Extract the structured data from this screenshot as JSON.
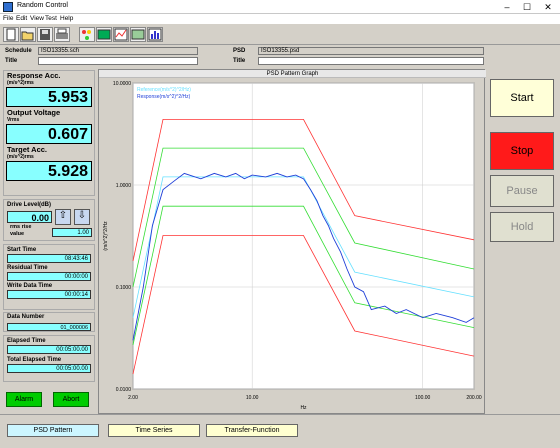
{
  "window": {
    "title": "Random Control",
    "min": "–",
    "max": "☐",
    "close": "✕"
  },
  "menu": [
    "File",
    "Edit",
    "View",
    "Test",
    "Help"
  ],
  "toolbar": {
    "icons": [
      "new-file-icon",
      "open-file-icon",
      "save-icon",
      "print-icon",
      "traffic-light-icon",
      "monitor-icon",
      "chart-icon",
      "display-icon",
      "bar-chart-icon"
    ]
  },
  "info": {
    "schedule_label": "Schedule",
    "schedule_value": "ISO13355.sch",
    "psd_label": "PSD",
    "psd_value": "ISO13355.psd",
    "title_label": "Title",
    "title_value": "",
    "title2_label": "Title",
    "title2_value": ""
  },
  "readouts": {
    "response": {
      "label": "Response Acc.",
      "unit": "(m/s^2)rms",
      "value": "5.953"
    },
    "output": {
      "label": "Output Voltage",
      "unit": "Vrms",
      "value": "0.607"
    },
    "target": {
      "label": "Target Acc.",
      "unit": "(m/s^2)rms",
      "value": "5.928"
    }
  },
  "drive": {
    "label": "Drive Level(dB)",
    "value": "0.00",
    "rise_label": "rms rise",
    "rise_label2": "value",
    "rise_value": "1.00"
  },
  "times": {
    "start": {
      "label": "Start Time",
      "value": "08:43:46"
    },
    "residual": {
      "label": "Residual Time",
      "value": "00:00:00"
    },
    "write": {
      "label": "Write Data Time",
      "value": "00:00:14"
    },
    "datanum": {
      "label": "Data Number",
      "value": "01_000006"
    },
    "elapsed": {
      "label": "Elapsed Time",
      "value": "00:05:00.00"
    },
    "total": {
      "label": "Total Elapsed Time",
      "value": "00:05:00.00"
    }
  },
  "buttons": {
    "alarm": "Alarm",
    "abort": "Abort",
    "start": "Start",
    "stop": "Stop",
    "pause": "Pause",
    "hold": "Hold"
  },
  "tabs": [
    "PSD Pattern",
    "Time Series",
    "Transfer-Function"
  ],
  "chart_data": {
    "type": "line",
    "title": "PSD Pattern Graph",
    "xlabel": "Hz",
    "ylabel": "(m/s^2)^2/Hz",
    "xscale": "log",
    "yscale": "log",
    "xlim": [
      2,
      200
    ],
    "ylim": [
      0.01,
      10
    ],
    "xticks": [
      "2.00",
      "10.00",
      "100.00",
      "200.00"
    ],
    "yticks": [
      "10.0000",
      "1.0000",
      "0.1000",
      "0.0100"
    ],
    "legend": [
      "Reference(m/s^2)^2/Hz)",
      "Response(m/s^2)^2/Hz)"
    ],
    "colors": {
      "reference": "#66e0ff",
      "response": "#1f3fd8",
      "abort": "#ff3333",
      "alarm": "#33dd33"
    },
    "series": [
      {
        "name": "Reference",
        "x": [
          2,
          3,
          20,
          40,
          200
        ],
        "y": [
          0.05,
          1.2,
          1.2,
          0.14,
          0.08
        ]
      },
      {
        "name": "upper abort",
        "x": [
          2,
          3,
          20,
          40,
          200
        ],
        "y": [
          0.18,
          4.4,
          4.4,
          0.5,
          0.29
        ]
      },
      {
        "name": "upper alarm",
        "x": [
          2,
          3,
          20,
          40,
          200
        ],
        "y": [
          0.1,
          2.3,
          2.3,
          0.27,
          0.15
        ]
      },
      {
        "name": "lower alarm",
        "x": [
          2,
          3,
          20,
          40,
          200
        ],
        "y": [
          0.027,
          0.62,
          0.62,
          0.07,
          0.04
        ]
      },
      {
        "name": "lower abort",
        "x": [
          2,
          3,
          20,
          40,
          200
        ],
        "y": [
          0.014,
          0.32,
          0.32,
          0.037,
          0.021
        ]
      },
      {
        "name": "Response",
        "x": [
          2,
          2.3,
          2.6,
          3,
          3.5,
          4,
          5,
          6,
          7,
          8,
          9,
          10,
          12,
          14,
          16,
          18,
          20,
          22,
          24,
          26,
          28,
          30,
          33,
          36,
          40,
          45,
          50,
          60,
          70,
          80,
          100,
          120,
          150,
          180,
          200
        ],
        "y": [
          0.03,
          0.1,
          0.4,
          0.9,
          1.1,
          1.3,
          1.15,
          1.3,
          1.2,
          1.3,
          1.15,
          1.25,
          1.2,
          1.3,
          1.2,
          1.25,
          1.15,
          0.9,
          0.7,
          0.5,
          0.4,
          0.3,
          0.22,
          0.15,
          0.1,
          0.09,
          0.06,
          0.065,
          0.055,
          0.06,
          0.05,
          0.055,
          0.05,
          0.045,
          0.05
        ]
      }
    ]
  }
}
